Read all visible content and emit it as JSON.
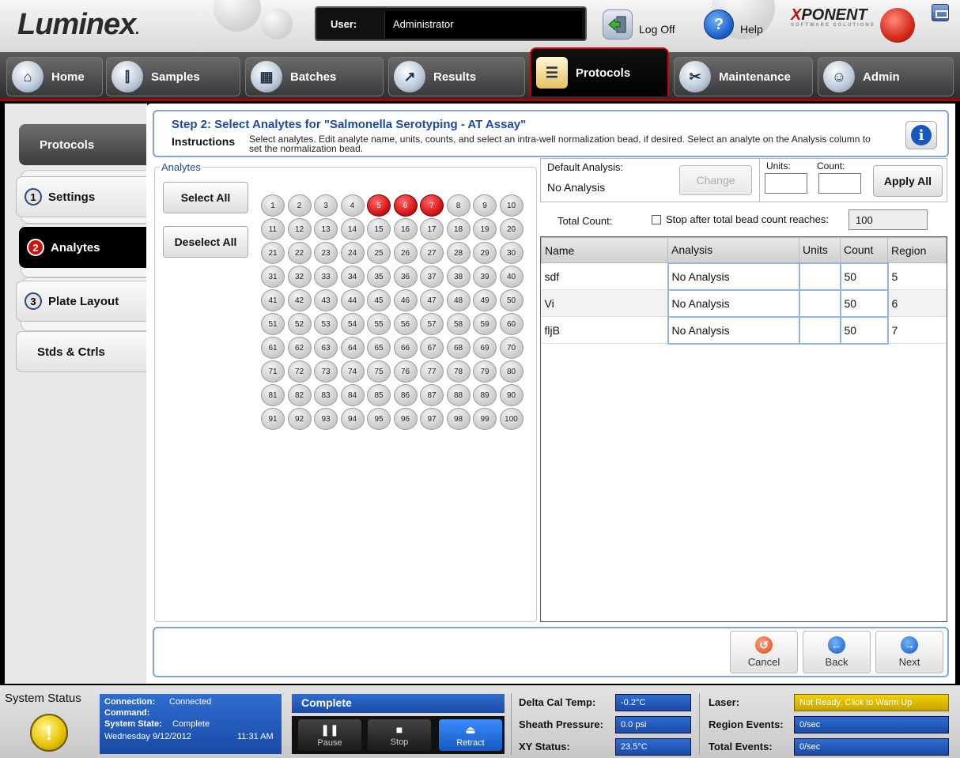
{
  "header": {
    "logo_text": "Luminex",
    "user_label": "User:",
    "user_name": "Administrator",
    "logoff_label": "Log Off",
    "help_label": "Help",
    "brand_name": "XPONENT",
    "brand_sub": "SOFTWARE SOLUTIONS"
  },
  "nav": {
    "tabs": [
      {
        "label": "Home",
        "icon": "home-icon"
      },
      {
        "label": "Samples",
        "icon": "samples-icon"
      },
      {
        "label": "Batches",
        "icon": "batches-icon"
      },
      {
        "label": "Results",
        "icon": "results-icon"
      },
      {
        "label": "Protocols",
        "icon": "protocols-icon",
        "active": true
      },
      {
        "label": "Maintenance",
        "icon": "maintenance-icon"
      },
      {
        "label": "Admin",
        "icon": "admin-icon"
      }
    ]
  },
  "left_nav": {
    "protocols": "Protocols",
    "settings": {
      "num": "1",
      "label": "Settings"
    },
    "analytes": {
      "num": "2",
      "label": "Analytes"
    },
    "plate_layout": {
      "num": "3",
      "label": "Plate Layout"
    },
    "stds_ctrls": "Stds & Ctrls"
  },
  "step": {
    "title": "Step 2: Select Analytes for \"Salmonella Serotyping - AT Assay\"",
    "instructions_label": "Instructions",
    "instructions_text": "Select analytes. Edit analyte name, units, counts, and select an intra-well normalization bead, if desired. Select an analyte on the Analysis column to set the normalization bead."
  },
  "analytes_panel": {
    "legend": "Analytes",
    "select_all": "Select All",
    "deselect_all": "Deselect All",
    "bead_count": 100,
    "selected_beads": [
      5,
      6,
      7
    ]
  },
  "default_analysis": {
    "label": "Default Analysis:",
    "value": "No Analysis",
    "change": "Change",
    "units_label": "Units:",
    "count_label": "Count:",
    "units_value": "",
    "count_value": "",
    "apply_all": "Apply All"
  },
  "total_count": {
    "label": "Total Count:",
    "stop_label": "Stop after total bead count reaches:",
    "stop_checked": false,
    "value": "100"
  },
  "table": {
    "headers": [
      "Name",
      "Analysis",
      "Units",
      "Count",
      "Region"
    ],
    "rows": [
      {
        "name": "sdf",
        "analysis": "No Analysis",
        "units": "",
        "count": "50",
        "region": "5"
      },
      {
        "name": "Vi",
        "analysis": "No Analysis",
        "units": "",
        "count": "50",
        "region": "6"
      },
      {
        "name": "fljB",
        "analysis": "No Analysis",
        "units": "",
        "count": "50",
        "region": "7"
      }
    ]
  },
  "footer_buttons": {
    "cancel": "Cancel",
    "back": "Back",
    "next": "Next"
  },
  "status": {
    "system_status": "System Status",
    "connection_label": "Connection:",
    "connection_value": "Connected",
    "command_label": "Command:",
    "command_value": "",
    "state_label": "System State:",
    "state_value": "Complete",
    "date": "Wednesday 9/12/2012",
    "time": "11:31 AM",
    "complete": "Complete",
    "pause": "Pause",
    "stop": "Stop",
    "retract": "Retract",
    "delta_cal_label": "Delta Cal Temp:",
    "delta_cal_value": "-0.2°C",
    "sheath_label": "Sheath Pressure:",
    "sheath_value": "0.0 psi",
    "xy_label": "XY Status:",
    "xy_value": "23.5°C",
    "laser_label": "Laser:",
    "laser_value": "Not Ready, Click to Warm Up",
    "region_events_label": "Region Events:",
    "region_events_value": "0/sec",
    "total_events_label": "Total Events:",
    "total_events_value": "0/sec"
  },
  "colors": {
    "accent_blue": "#1b4aa0",
    "status_blue": "#1a4aa6",
    "selected_bead_red": "#d41111",
    "laser_warn": "#e6c000"
  }
}
